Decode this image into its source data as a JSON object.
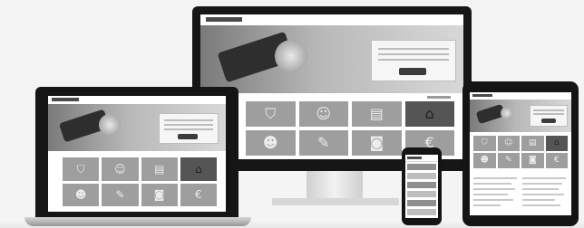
{
  "scene": {
    "monitor": {
      "tiles": [
        {
          "icon": "shield-icon",
          "glyph": "⛉",
          "dark": false
        },
        {
          "icon": "user-icon",
          "glyph": "☺",
          "dark": false
        },
        {
          "icon": "document-icon",
          "glyph": "▤",
          "dark": false
        },
        {
          "icon": "bank-icon",
          "glyph": "⌂",
          "dark": true
        },
        {
          "icon": "add-user-icon",
          "glyph": "☻",
          "dark": false
        },
        {
          "icon": "tools-icon",
          "glyph": "✎",
          "dark": false
        },
        {
          "icon": "camera-icon",
          "glyph": "◙",
          "dark": false
        },
        {
          "icon": "euro-icon",
          "glyph": "€",
          "dark": false
        }
      ]
    },
    "laptop": {
      "tiles": [
        {
          "icon": "shield-icon",
          "glyph": "⛉",
          "dark": false
        },
        {
          "icon": "user-icon",
          "glyph": "☺",
          "dark": false
        },
        {
          "icon": "document-icon",
          "glyph": "▤",
          "dark": false
        },
        {
          "icon": "bank-icon",
          "glyph": "⌂",
          "dark": true
        },
        {
          "icon": "add-user-icon",
          "glyph": "☻",
          "dark": false
        },
        {
          "icon": "tools-icon",
          "glyph": "✎",
          "dark": false
        },
        {
          "icon": "camera-icon",
          "glyph": "◙",
          "dark": false
        },
        {
          "icon": "euro-icon",
          "glyph": "€",
          "dark": false
        }
      ]
    },
    "tablet": {
      "tiles": [
        {
          "icon": "shield-icon",
          "glyph": "⛉",
          "dark": false
        },
        {
          "icon": "user-icon",
          "glyph": "☺",
          "dark": false
        },
        {
          "icon": "document-icon",
          "glyph": "▤",
          "dark": false
        },
        {
          "icon": "bank-icon",
          "glyph": "⌂",
          "dark": true
        },
        {
          "icon": "add-user-icon",
          "glyph": "☻",
          "dark": false
        },
        {
          "icon": "tools-icon",
          "glyph": "✎",
          "dark": false
        },
        {
          "icon": "camera-icon",
          "glyph": "◙",
          "dark": false
        },
        {
          "icon": "euro-icon",
          "glyph": "€",
          "dark": false
        }
      ]
    },
    "phone": {
      "menu_items": 6
    },
    "colors": {
      "bezel": "#161616",
      "tile": "#9e9e9e",
      "tile_dark": "#555555",
      "callout_button": "#3b3b3b"
    }
  }
}
